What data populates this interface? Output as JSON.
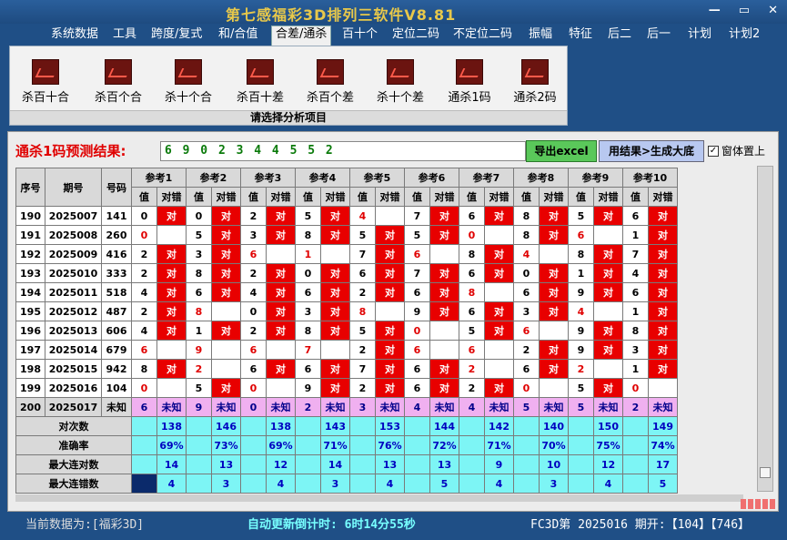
{
  "window": {
    "title": "第七感福彩3D排列三软件V8.81"
  },
  "menu": [
    "系统数据",
    "工具",
    "跨度/复式",
    "和/合值",
    "合差/通杀",
    "百十个",
    "定位二码",
    "不定位二码",
    "振幅",
    "特征",
    "后二",
    "后一",
    "计划",
    "计划2"
  ],
  "menu_active": "合差/通杀",
  "ribbon": {
    "buttons": [
      "杀百十合",
      "杀百个合",
      "杀十个合",
      "杀百十差",
      "杀百个差",
      "杀十个差",
      "通杀1码",
      "通杀2码"
    ],
    "footer": "请选择分析项目"
  },
  "prediction": {
    "label": "通杀1码预测结果:",
    "value": "6 9 0 2 3 4 4 5 5 2",
    "export_label": "导出excel",
    "generate_label": "用结果>生成大底",
    "checkbox_label": "窗体置上",
    "checkbox_checked": true
  },
  "table": {
    "headers": {
      "seq": "序号",
      "period": "期号",
      "number": "号码",
      "value": "值",
      "check": "对错"
    },
    "refs": [
      "参考1",
      "参考2",
      "参考3",
      "参考4",
      "参考5",
      "参考6",
      "参考7",
      "参考8",
      "参考9",
      "参考10"
    ],
    "rows": [
      {
        "seq": "190",
        "period": "2025007",
        "number": "141",
        "cells": [
          [
            "0",
            "对"
          ],
          [
            "0",
            "对"
          ],
          [
            "2",
            "对"
          ],
          [
            "5",
            "对"
          ],
          [
            "4",
            ""
          ],
          [
            "7",
            "对"
          ],
          [
            "6",
            "对"
          ],
          [
            "8",
            "对"
          ],
          [
            "5",
            "对"
          ],
          [
            "6",
            "对"
          ]
        ]
      },
      {
        "seq": "191",
        "period": "2025008",
        "number": "260",
        "cells": [
          [
            "0",
            ""
          ],
          [
            "5",
            "对"
          ],
          [
            "3",
            "对"
          ],
          [
            "8",
            "对"
          ],
          [
            "5",
            "对"
          ],
          [
            "5",
            "对"
          ],
          [
            "0",
            ""
          ],
          [
            "8",
            "对"
          ],
          [
            "6",
            ""
          ],
          [
            "1",
            "对"
          ]
        ]
      },
      {
        "seq": "192",
        "period": "2025009",
        "number": "416",
        "cells": [
          [
            "2",
            "对"
          ],
          [
            "3",
            "对"
          ],
          [
            "6",
            ""
          ],
          [
            "1",
            ""
          ],
          [
            "7",
            "对"
          ],
          [
            "6",
            ""
          ],
          [
            "8",
            "对"
          ],
          [
            "4",
            ""
          ],
          [
            "8",
            "对"
          ],
          [
            "7",
            "对"
          ]
        ]
      },
      {
        "seq": "193",
        "period": "2025010",
        "number": "333",
        "cells": [
          [
            "2",
            "对"
          ],
          [
            "8",
            "对"
          ],
          [
            "2",
            "对"
          ],
          [
            "0",
            "对"
          ],
          [
            "6",
            "对"
          ],
          [
            "7",
            "对"
          ],
          [
            "6",
            "对"
          ],
          [
            "0",
            "对"
          ],
          [
            "1",
            "对"
          ],
          [
            "4",
            "对"
          ]
        ]
      },
      {
        "seq": "194",
        "period": "2025011",
        "number": "518",
        "cells": [
          [
            "4",
            "对"
          ],
          [
            "6",
            "对"
          ],
          [
            "4",
            "对"
          ],
          [
            "6",
            "对"
          ],
          [
            "2",
            "对"
          ],
          [
            "6",
            "对"
          ],
          [
            "8",
            ""
          ],
          [
            "6",
            "对"
          ],
          [
            "9",
            "对"
          ],
          [
            "6",
            "对"
          ]
        ]
      },
      {
        "seq": "195",
        "period": "2025012",
        "number": "487",
        "cells": [
          [
            "2",
            "对"
          ],
          [
            "8",
            ""
          ],
          [
            "0",
            "对"
          ],
          [
            "3",
            "对"
          ],
          [
            "8",
            ""
          ],
          [
            "9",
            "对"
          ],
          [
            "6",
            "对"
          ],
          [
            "3",
            "对"
          ],
          [
            "4",
            ""
          ],
          [
            "1",
            "对"
          ]
        ]
      },
      {
        "seq": "196",
        "period": "2025013",
        "number": "606",
        "cells": [
          [
            "4",
            "对"
          ],
          [
            "1",
            "对"
          ],
          [
            "2",
            "对"
          ],
          [
            "8",
            "对"
          ],
          [
            "5",
            "对"
          ],
          [
            "0",
            ""
          ],
          [
            "5",
            "对"
          ],
          [
            "6",
            ""
          ],
          [
            "9",
            "对"
          ],
          [
            "8",
            "对"
          ]
        ]
      },
      {
        "seq": "197",
        "period": "2025014",
        "number": "679",
        "cells": [
          [
            "6",
            ""
          ],
          [
            "9",
            ""
          ],
          [
            "6",
            ""
          ],
          [
            "7",
            ""
          ],
          [
            "2",
            "对"
          ],
          [
            "6",
            ""
          ],
          [
            "6",
            ""
          ],
          [
            "2",
            "对"
          ],
          [
            "9",
            "对"
          ],
          [
            "3",
            "对"
          ]
        ]
      },
      {
        "seq": "198",
        "period": "2025015",
        "number": "942",
        "cells": [
          [
            "8",
            "对"
          ],
          [
            "2",
            ""
          ],
          [
            "6",
            "对"
          ],
          [
            "6",
            "对"
          ],
          [
            "7",
            "对"
          ],
          [
            "6",
            "对"
          ],
          [
            "2",
            ""
          ],
          [
            "6",
            "对"
          ],
          [
            "2",
            ""
          ],
          [
            "1",
            "对"
          ]
        ]
      },
      {
        "seq": "199",
        "period": "2025016",
        "number": "104",
        "cells": [
          [
            "0",
            ""
          ],
          [
            "5",
            "对"
          ],
          [
            "0",
            ""
          ],
          [
            "9",
            "对"
          ],
          [
            "2",
            "对"
          ],
          [
            "6",
            "对"
          ],
          [
            "2",
            "对"
          ],
          [
            "0",
            ""
          ],
          [
            "5",
            "对"
          ],
          [
            "0",
            ""
          ]
        ]
      }
    ],
    "unknown_row": {
      "seq": "200",
      "period": "2025017",
      "number": "未知",
      "values": [
        "6",
        "9",
        "0",
        "2",
        "3",
        "4",
        "4",
        "5",
        "5",
        "2"
      ],
      "unknown_label": "未知"
    },
    "stats": [
      {
        "label": "对次数",
        "values": [
          "138",
          "146",
          "138",
          "143",
          "153",
          "144",
          "142",
          "140",
          "150",
          "149"
        ]
      },
      {
        "label": "准确率",
        "values": [
          "69%",
          "73%",
          "69%",
          "71%",
          "76%",
          "72%",
          "71%",
          "70%",
          "75%",
          "74%"
        ]
      },
      {
        "label": "最大连对数",
        "values": [
          "14",
          "13",
          "12",
          "14",
          "13",
          "13",
          "9",
          "10",
          "12",
          "17"
        ]
      },
      {
        "label": "最大连错数",
        "values": [
          "4",
          "3",
          "4",
          "3",
          "4",
          "5",
          "4",
          "3",
          "4",
          "5"
        ]
      }
    ]
  },
  "statusbar": {
    "current": "当前数据为:[福彩3D]",
    "countdown": "自动更新倒计时: 6时14分55秒",
    "draw": "FC3D第 2025016 期开:【104】【746】"
  },
  "colors": {
    "hit": "#e80000",
    "highlight_value": "#e00000",
    "pink": "#f0b0f0",
    "cyan": "#7df5f5",
    "title": "#e8c84a"
  }
}
